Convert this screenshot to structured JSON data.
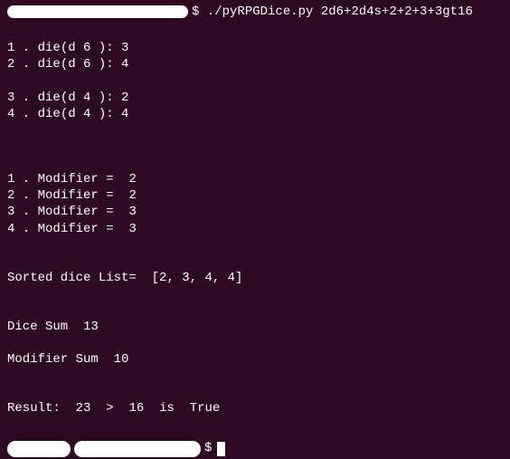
{
  "prompt": {
    "symbol": "$",
    "command": "./pyRPGDice.py 2d6+2d4s+2+2+3+3gt16"
  },
  "die_rolls": [
    {
      "idx": "1",
      "sides": "6",
      "value": "3"
    },
    {
      "idx": "2",
      "sides": "6",
      "value": "4"
    },
    {
      "idx": "3",
      "sides": "4",
      "value": "2"
    },
    {
      "idx": "4",
      "sides": "4",
      "value": "4"
    }
  ],
  "modifiers": [
    {
      "idx": "1",
      "value": "2"
    },
    {
      "idx": "2",
      "value": "2"
    },
    {
      "idx": "3",
      "value": "3"
    },
    {
      "idx": "4",
      "value": "3"
    }
  ],
  "sorted_label": "Sorted dice List=",
  "sorted_list": "[2, 3, 4, 4]",
  "dice_sum_label": "Dice Sum",
  "dice_sum_value": "13",
  "modifier_sum_label": "Modifier Sum",
  "modifier_sum_value": "10",
  "result": {
    "label": "Result:",
    "total": "23",
    "operator": ">",
    "target": "16",
    "is": "is",
    "outcome": "True"
  }
}
